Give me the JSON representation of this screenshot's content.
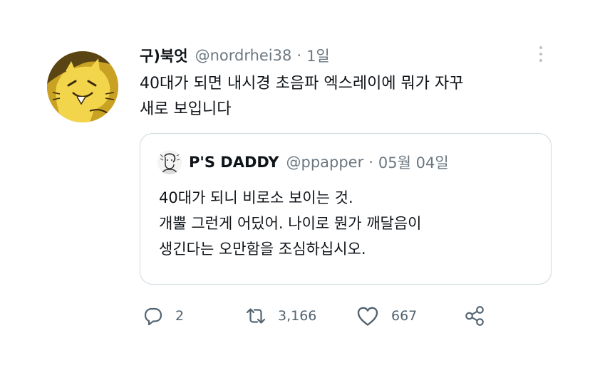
{
  "author": {
    "display_name": "구)북엇",
    "handle": "@nordrhei38",
    "separator": "·",
    "time": "1일",
    "avatar_icon": "cartoon-cat-avatar-icon"
  },
  "tweet": {
    "lines": [
      "40대가 되면 내시경 초음파 엑스레이에 뭐가 자꾸",
      "새로 보입니다"
    ]
  },
  "quoted": {
    "display_name": "P'S DADDY",
    "handle": "@ppapper",
    "separator": "·",
    "time": "05월 04일",
    "avatar_icon": "sketch-portrait-avatar-icon",
    "lines": [
      "40대가 되니 비로소 보이는 것.",
      "개뿔 그런게 어딨어. 나이로 뭔가 깨달음이",
      "생긴다는 오만함을 조심하십시오."
    ]
  },
  "actions": {
    "reply": {
      "icon": "reply-icon",
      "count": "2"
    },
    "retweet": {
      "icon": "retweet-icon",
      "count": "3,166"
    },
    "like": {
      "icon": "heart-icon",
      "count": "667"
    },
    "share": {
      "icon": "share-icon"
    }
  },
  "colors": {
    "text": "#0f1419",
    "secondary": "#6b7780",
    "action": "#536471",
    "border": "#cfd9de",
    "avatar": "#c9a224"
  }
}
